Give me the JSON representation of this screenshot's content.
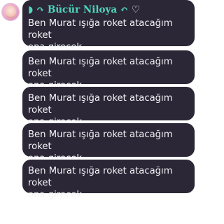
{
  "chat": {
    "sender": {
      "name_prefix": "◗ ↷ ",
      "name": "Bücür Niloya",
      "name_suffix": " ↶ ",
      "heart": "♡"
    },
    "messages": [
      {
        "text": "Ben Murat ışığa roket atacağım roket\nona girecek"
      },
      {
        "text": "Ben Murat ışığa roket atacağım roket\nona girecek"
      },
      {
        "text": "Ben Murat ışığa roket atacağım roket\nona girecek"
      },
      {
        "text": "Ben Murat ışığa roket atacağım roket\nona girecek"
      },
      {
        "text": "Ben Murat ışığa roket atacağım roket\nona girecek"
      }
    ]
  },
  "colors": {
    "bubble": "#2b2736",
    "username": "#4fd7bf",
    "text": "#f3f3f6"
  }
}
